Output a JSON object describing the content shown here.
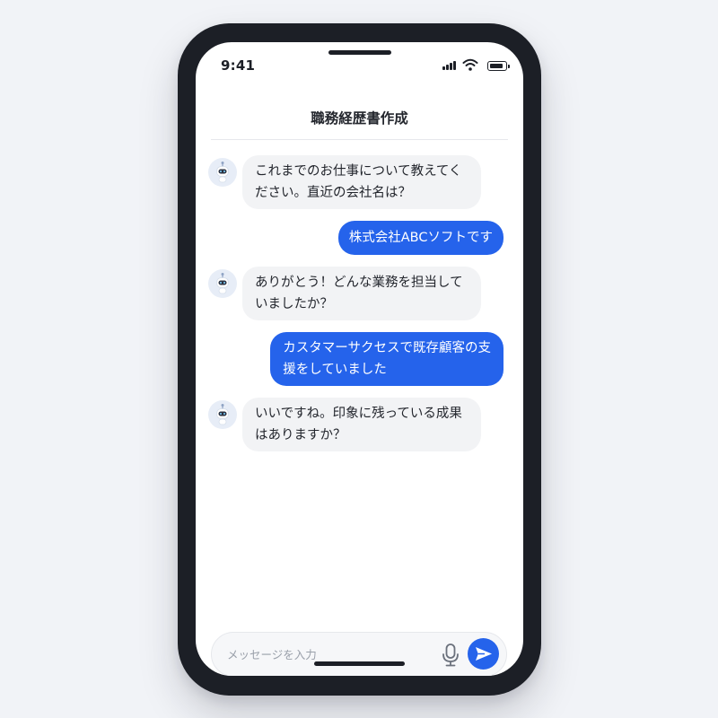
{
  "status": {
    "time": "9:41"
  },
  "header": {
    "title": "職務経歴書作成"
  },
  "messages": [
    {
      "sender": "bot",
      "lines": [
        "これまでのお仕事について教えてく",
        "ださい。直近の会社名は？"
      ]
    },
    {
      "sender": "user",
      "lines": [
        "株式会社ABCソフトです"
      ]
    },
    {
      "sender": "bot",
      "lines": [
        "ありがとう！どんな業務を担当して",
        "いましたか？"
      ]
    },
    {
      "sender": "user",
      "lines": [
        "カスタマーサクセスで既存顧客の支",
        "援をしていました"
      ]
    },
    {
      "sender": "bot",
      "lines": [
        "いいですね。印象に残っている成果",
        "はありますか？"
      ]
    }
  ],
  "composer": {
    "placeholder": "メッセージを入力",
    "value": ""
  },
  "icons": {
    "avatar": "robot-icon",
    "mic": "microphone-icon",
    "send": "send-icon",
    "signal": "signal-icon",
    "wifi": "wifi-icon",
    "battery": "battery-icon"
  },
  "colors": {
    "accent": "#2563eb",
    "bot_bubble": "#f2f3f5",
    "frame": "#1c1f26",
    "background": "#f1f3f7"
  }
}
